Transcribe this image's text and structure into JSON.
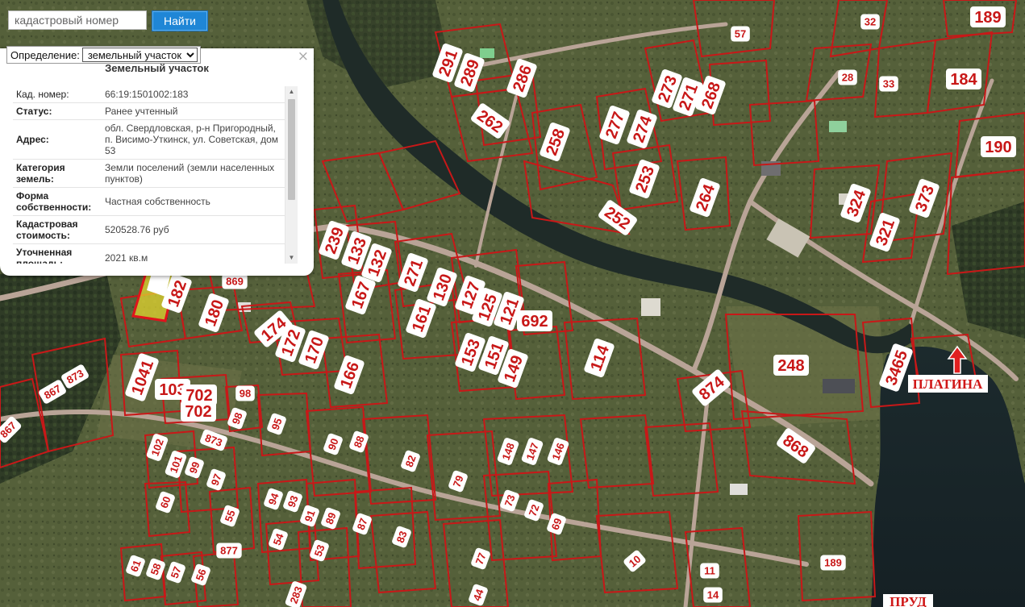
{
  "search": {
    "placeholder": "кадастровый номер",
    "value": "",
    "button_label": "Найти"
  },
  "popup": {
    "definition_label": "Определение:",
    "definition_value": "земельный участок",
    "close_glyph": "×",
    "title": "Земельный участок",
    "rows": [
      {
        "label": "Кад. номер:",
        "value": "66:19:1501002:183"
      },
      {
        "label": "Статус:",
        "value": "Ранее учтенный"
      },
      {
        "label": "Адрес:",
        "value": "обл. Свердловская, р-н Пригородный, п. Висимо-Уткинск, ул. Советская, дом 53"
      },
      {
        "label": "Категория земель:",
        "value": "Земли поселений (земли населенных пунктов)"
      },
      {
        "label": "Форма собственности:",
        "value": "Частная собственность"
      },
      {
        "label": "Кадастровая стоимость:",
        "value": "520528.76 руб"
      },
      {
        "label": "Уточненная площадь:",
        "value": "2021 кв.м"
      }
    ]
  },
  "map": {
    "colors": {
      "parcel_border": "#c81818",
      "label_fill": "#ffffff",
      "label_text": "#c81818",
      "water": "#1e2c2e",
      "road": "#c8a89f"
    },
    "labels": {
      "platina": "ПЛАТИНА",
      "prud": "ПРУД"
    },
    "parcel_numbers": [
      {
        "text": "291"
      },
      {
        "text": "289"
      },
      {
        "text": "286"
      },
      {
        "text": "262"
      },
      {
        "text": "258"
      },
      {
        "text": "277"
      },
      {
        "text": "274"
      },
      {
        "text": "273"
      },
      {
        "text": "271"
      },
      {
        "text": "268"
      },
      {
        "text": "253"
      },
      {
        "text": "264"
      },
      {
        "text": "252"
      },
      {
        "text": "57"
      },
      {
        "text": "32"
      },
      {
        "text": "28"
      },
      {
        "text": "33"
      },
      {
        "text": "184"
      },
      {
        "text": "189"
      },
      {
        "text": "190"
      },
      {
        "text": "324"
      },
      {
        "text": "321"
      },
      {
        "text": "373"
      },
      {
        "text": "239"
      },
      {
        "text": "133"
      },
      {
        "text": "132"
      },
      {
        "text": "271"
      },
      {
        "text": "130"
      },
      {
        "text": "127"
      },
      {
        "text": "125"
      },
      {
        "text": "121"
      },
      {
        "text": "692"
      },
      {
        "text": "167"
      },
      {
        "text": "161"
      },
      {
        "text": "153"
      },
      {
        "text": "151"
      },
      {
        "text": "149"
      },
      {
        "text": "114"
      },
      {
        "text": "248"
      },
      {
        "text": "3465"
      },
      {
        "text": "874"
      },
      {
        "text": "868"
      },
      {
        "text": "182"
      },
      {
        "text": "180"
      },
      {
        "text": "174"
      },
      {
        "text": "172"
      },
      {
        "text": "170"
      },
      {
        "text": "166"
      },
      {
        "text": "869"
      },
      {
        "text": "1041"
      },
      {
        "text": "103"
      },
      {
        "text": "702"
      },
      {
        "text": "702"
      },
      {
        "text": "98"
      },
      {
        "text": "98"
      },
      {
        "text": "95"
      },
      {
        "text": "873"
      },
      {
        "text": "873"
      },
      {
        "text": "867"
      },
      {
        "text": "867"
      },
      {
        "text": "90"
      },
      {
        "text": "88"
      },
      {
        "text": "82"
      },
      {
        "text": "79"
      },
      {
        "text": "148"
      },
      {
        "text": "147"
      },
      {
        "text": "146"
      },
      {
        "text": "102"
      },
      {
        "text": "101"
      },
      {
        "text": "99"
      },
      {
        "text": "97"
      },
      {
        "text": "60"
      },
      {
        "text": "55"
      },
      {
        "text": "94"
      },
      {
        "text": "93"
      },
      {
        "text": "91"
      },
      {
        "text": "89"
      },
      {
        "text": "87"
      },
      {
        "text": "73"
      },
      {
        "text": "72"
      },
      {
        "text": "69"
      },
      {
        "text": "83"
      },
      {
        "text": "54"
      },
      {
        "text": "53"
      },
      {
        "text": "877"
      },
      {
        "text": "77"
      },
      {
        "text": "10"
      },
      {
        "text": "11"
      },
      {
        "text": "14"
      },
      {
        "text": "189"
      },
      {
        "text": "61"
      },
      {
        "text": "58"
      },
      {
        "text": "57"
      },
      {
        "text": "56"
      },
      {
        "text": "44"
      },
      {
        "text": "283"
      }
    ]
  }
}
